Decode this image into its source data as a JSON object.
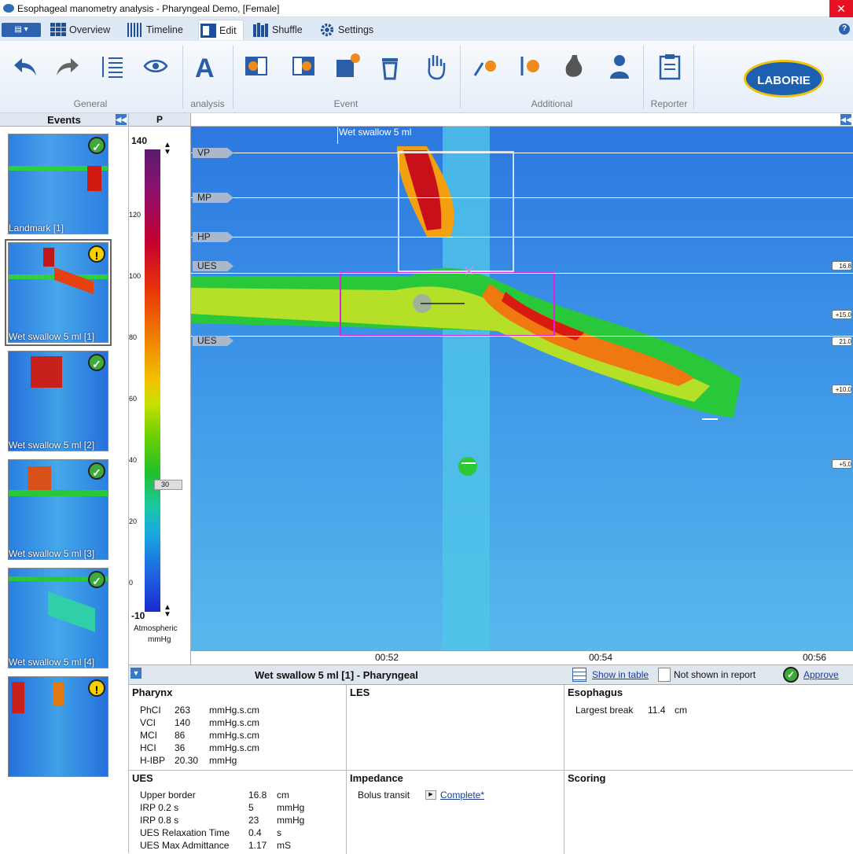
{
  "window": {
    "title": "Esophageal manometry analysis - Pharyngeal Demo,  [Female]",
    "close_label": "✕"
  },
  "tabs": [
    {
      "label": "Overview"
    },
    {
      "label": "Timeline"
    },
    {
      "label": "Edit"
    },
    {
      "label": "Shuffle"
    },
    {
      "label": "Settings"
    }
  ],
  "ribbon": {
    "groups": [
      "General",
      "analysis",
      "Event",
      "Additional",
      "Reporter"
    ],
    "logo": "LABORIE"
  },
  "events_panel": {
    "title": "Events",
    "items": [
      {
        "label": "Landmark [1]",
        "status": "ok"
      },
      {
        "label": "Wet swallow 5 ml [1]",
        "status": "warn"
      },
      {
        "label": "Wet swallow 5 ml [2]",
        "status": "ok"
      },
      {
        "label": "Wet swallow 5 ml [3]",
        "status": "ok"
      },
      {
        "label": "Wet swallow 5 ml [4]",
        "status": "ok"
      },
      {
        "label": "",
        "status": "warn"
      }
    ]
  },
  "scale": {
    "title": "P",
    "max": "140",
    "min": "-10",
    "ticks": [
      "120",
      "100",
      "80",
      "60",
      "40",
      "20",
      "0"
    ],
    "marker": "30",
    "unit_line1": "Atmospheric",
    "unit_line2": "mmHg"
  },
  "plot": {
    "event_label": "Wet swallow 5 ml",
    "landmarks": [
      "VP",
      "MP",
      "HP",
      "UES",
      "UES"
    ],
    "right_tags": [
      "16.8",
      "+15.0",
      "21.0",
      "+10.0",
      "+5.0"
    ],
    "time_labels": [
      "00:52",
      "00:54",
      "00:56"
    ]
  },
  "summary": {
    "title": "Wet swallow 5 ml [1]  -  Pharyngeal",
    "show_in_table": "Show in table",
    "not_shown": "Not shown in report",
    "approve": "Approve"
  },
  "pharynx": {
    "title": "Pharynx",
    "rows": [
      {
        "k": "PhCI",
        "v": "263",
        "u": "mmHg.s.cm"
      },
      {
        "k": "VCI",
        "v": "140",
        "u": "mmHg.s.cm"
      },
      {
        "k": "MCI",
        "v": "86",
        "u": "mmHg.s.cm"
      },
      {
        "k": "HCI",
        "v": "36",
        "u": "mmHg.s.cm"
      },
      {
        "k": "H-IBP",
        "v": "20.30",
        "u": "mmHg"
      }
    ]
  },
  "les": {
    "title": "LES"
  },
  "esophagus": {
    "title": "Esophagus",
    "label": "Largest break",
    "value": "11.4",
    "unit": "cm"
  },
  "ues": {
    "title": "UES",
    "rows": [
      {
        "k": "Upper border",
        "v": "16.8",
        "u": "cm"
      },
      {
        "k": "IRP 0.2 s",
        "v": "5",
        "u": "mmHg"
      },
      {
        "k": "IRP 0.8 s",
        "v": "23",
        "u": "mmHg"
      },
      {
        "k": "UES Relaxation Time",
        "v": "0.4",
        "u": "s"
      },
      {
        "k": "UES Max Admittance",
        "v": "1.17",
        "u": "mS"
      }
    ]
  },
  "impedance": {
    "title": "Impedance",
    "label": "Bolus transit",
    "value": "Complete*"
  },
  "scoring": {
    "title": "Scoring"
  }
}
